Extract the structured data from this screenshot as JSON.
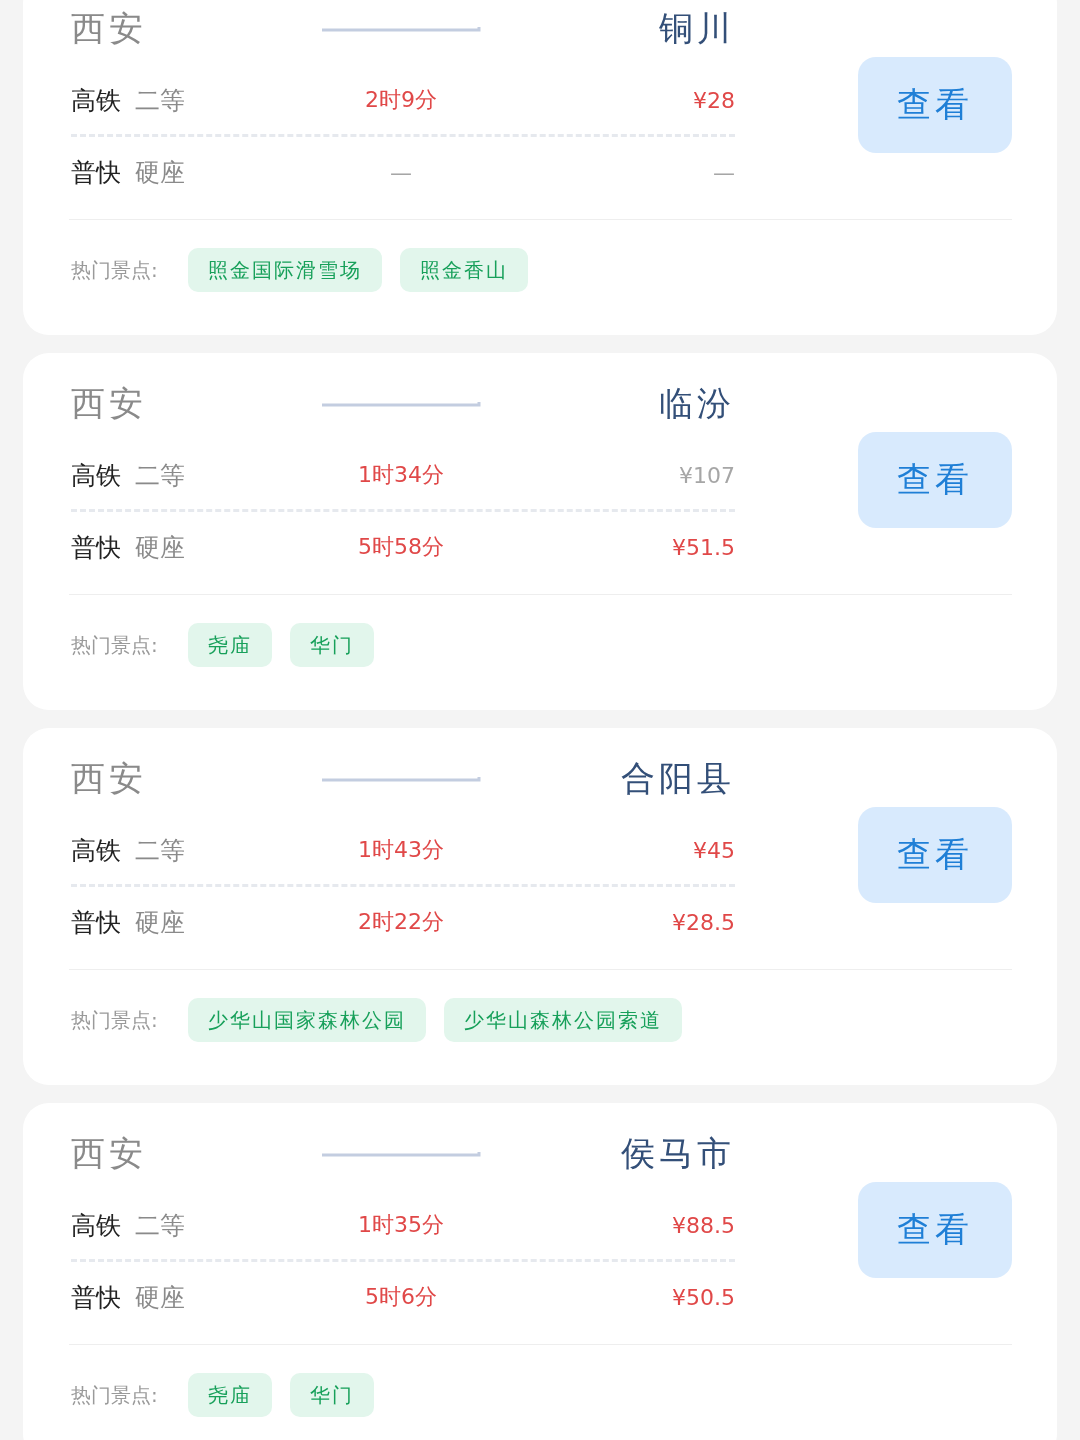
{
  "routes": [
    {
      "origin": "西安",
      "destination": "铜川",
      "trains": [
        {
          "type": "高铁",
          "seat": "二等",
          "duration": "2时9分",
          "duration_muted": false,
          "price": "¥28",
          "price_muted": false
        },
        {
          "type": "普快",
          "seat": "硬座",
          "duration": "—",
          "duration_muted": true,
          "price": "—",
          "price_muted": true
        }
      ],
      "button": "查看",
      "attractions_label": "热门景点:",
      "attractions": [
        "照金国际滑雪场",
        "照金香山"
      ]
    },
    {
      "origin": "西安",
      "destination": "临汾",
      "trains": [
        {
          "type": "高铁",
          "seat": "二等",
          "duration": "1时34分",
          "duration_muted": false,
          "price": "¥107",
          "price_muted": true
        },
        {
          "type": "普快",
          "seat": "硬座",
          "duration": "5时58分",
          "duration_muted": false,
          "price": "¥51.5",
          "price_muted": false
        }
      ],
      "button": "查看",
      "attractions_label": "热门景点:",
      "attractions": [
        "尧庙",
        "华门"
      ]
    },
    {
      "origin": "西安",
      "destination": "合阳县",
      "trains": [
        {
          "type": "高铁",
          "seat": "二等",
          "duration": "1时43分",
          "duration_muted": false,
          "price": "¥45",
          "price_muted": false
        },
        {
          "type": "普快",
          "seat": "硬座",
          "duration": "2时22分",
          "duration_muted": false,
          "price": "¥28.5",
          "price_muted": false
        }
      ],
      "button": "查看",
      "attractions_label": "热门景点:",
      "attractions": [
        "少华山国家森林公园",
        "少华山森林公园索道"
      ]
    },
    {
      "origin": "西安",
      "destination": "侯马市",
      "trains": [
        {
          "type": "高铁",
          "seat": "二等",
          "duration": "1时35分",
          "duration_muted": false,
          "price": "¥88.5",
          "price_muted": false
        },
        {
          "type": "普快",
          "seat": "硬座",
          "duration": "5时6分",
          "duration_muted": false,
          "price": "¥50.5",
          "price_muted": false
        }
      ],
      "button": "查看",
      "attractions_label": "热门景点:",
      "attractions": [
        "尧庙",
        "华门"
      ]
    }
  ]
}
